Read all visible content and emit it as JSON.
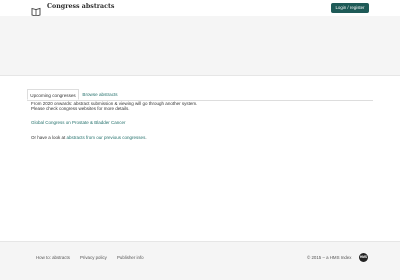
{
  "header": {
    "logo_icon": "open-book-icon",
    "title": "Congress abstracts",
    "login_label": "Login / register",
    "accent_color": "#1e5a57"
  },
  "main": {
    "tabs": [
      {
        "label": "Upcoming congresses",
        "active": true
      },
      {
        "label": "Browse abstracts",
        "active": false
      }
    ],
    "notice_line_1": "From 2020 onwards: abstract submission & viewing will go through another system.",
    "notice_line_2": "Please check congress websites for more details.",
    "congress_link": "Global Congress on Prostate & Bladder Cancer",
    "past_prefix": "Or have a look at ",
    "past_link": "abstracts from our previous congresses",
    "past_suffix": ".",
    "link_color": "#23706b"
  },
  "footer": {
    "links": [
      "How to: abstracts",
      "Privacy policy",
      "Publisher info"
    ],
    "copyright": "© 2015 – a HMS Index",
    "badge": "HMS",
    "badge_icon": "hms-logo-icon"
  }
}
